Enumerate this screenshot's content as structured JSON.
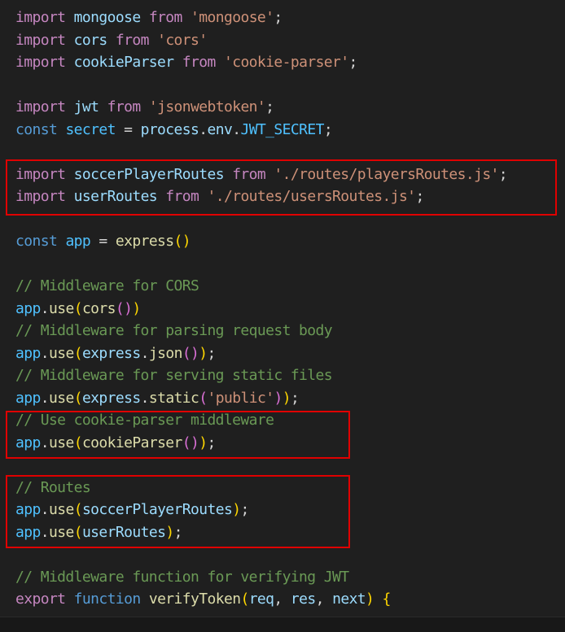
{
  "editor": {
    "language": "javascript",
    "lines": [
      {
        "tokens": [
          {
            "t": "import",
            "c": "kw"
          },
          {
            "t": " ",
            "c": "pl"
          },
          {
            "t": "mongoose",
            "c": "var"
          },
          {
            "t": " ",
            "c": "pl"
          },
          {
            "t": "from",
            "c": "kw"
          },
          {
            "t": " ",
            "c": "pl"
          },
          {
            "t": "'mongoose'",
            "c": "str"
          },
          {
            "t": ";",
            "c": "pl"
          }
        ]
      },
      {
        "tokens": [
          {
            "t": "import",
            "c": "kw"
          },
          {
            "t": " ",
            "c": "pl"
          },
          {
            "t": "cors",
            "c": "var"
          },
          {
            "t": " ",
            "c": "pl"
          },
          {
            "t": "from",
            "c": "kw"
          },
          {
            "t": " ",
            "c": "pl"
          },
          {
            "t": "'cors'",
            "c": "str"
          }
        ]
      },
      {
        "tokens": [
          {
            "t": "import",
            "c": "kw"
          },
          {
            "t": " ",
            "c": "pl"
          },
          {
            "t": "cookieParser",
            "c": "var"
          },
          {
            "t": " ",
            "c": "pl"
          },
          {
            "t": "from",
            "c": "kw"
          },
          {
            "t": " ",
            "c": "pl"
          },
          {
            "t": "'cookie-parser'",
            "c": "str"
          },
          {
            "t": ";",
            "c": "pl"
          }
        ]
      },
      {
        "tokens": []
      },
      {
        "tokens": [
          {
            "t": "import",
            "c": "kw"
          },
          {
            "t": " ",
            "c": "pl"
          },
          {
            "t": "jwt",
            "c": "var"
          },
          {
            "t": " ",
            "c": "pl"
          },
          {
            "t": "from",
            "c": "kw"
          },
          {
            "t": " ",
            "c": "pl"
          },
          {
            "t": "'jsonwebtoken'",
            "c": "str"
          },
          {
            "t": ";",
            "c": "pl"
          }
        ]
      },
      {
        "tokens": [
          {
            "t": "const",
            "c": "st"
          },
          {
            "t": " ",
            "c": "pl"
          },
          {
            "t": "secret",
            "c": "cv"
          },
          {
            "t": " = ",
            "c": "pl"
          },
          {
            "t": "process",
            "c": "var"
          },
          {
            "t": ".",
            "c": "pl"
          },
          {
            "t": "env",
            "c": "var"
          },
          {
            "t": ".",
            "c": "pl"
          },
          {
            "t": "JWT_SECRET",
            "c": "cv"
          },
          {
            "t": ";",
            "c": "pl"
          }
        ]
      },
      {
        "tokens": []
      },
      {
        "tokens": [
          {
            "t": "import",
            "c": "kw"
          },
          {
            "t": " ",
            "c": "pl"
          },
          {
            "t": "soccerPlayerRoutes",
            "c": "var"
          },
          {
            "t": " ",
            "c": "pl"
          },
          {
            "t": "from",
            "c": "kw"
          },
          {
            "t": " ",
            "c": "pl"
          },
          {
            "t": "'./routes/playersRoutes.js'",
            "c": "str"
          },
          {
            "t": ";",
            "c": "pl"
          }
        ]
      },
      {
        "tokens": [
          {
            "t": "import",
            "c": "kw"
          },
          {
            "t": " ",
            "c": "pl"
          },
          {
            "t": "userRoutes",
            "c": "var"
          },
          {
            "t": " ",
            "c": "pl"
          },
          {
            "t": "from",
            "c": "kw"
          },
          {
            "t": " ",
            "c": "pl"
          },
          {
            "t": "'./routes/usersRoutes.js'",
            "c": "str"
          },
          {
            "t": ";",
            "c": "pl"
          }
        ]
      },
      {
        "tokens": []
      },
      {
        "tokens": [
          {
            "t": "const",
            "c": "st"
          },
          {
            "t": " ",
            "c": "pl"
          },
          {
            "t": "app",
            "c": "cv"
          },
          {
            "t": " = ",
            "c": "pl"
          },
          {
            "t": "express",
            "c": "fn"
          },
          {
            "t": "()",
            "c": "b1"
          }
        ]
      },
      {
        "tokens": []
      },
      {
        "tokens": [
          {
            "t": "// Middleware for CORS",
            "c": "cm"
          }
        ]
      },
      {
        "tokens": [
          {
            "t": "app",
            "c": "cv"
          },
          {
            "t": ".",
            "c": "pl"
          },
          {
            "t": "use",
            "c": "fn"
          },
          {
            "t": "(",
            "c": "b1"
          },
          {
            "t": "cors",
            "c": "fn"
          },
          {
            "t": "()",
            "c": "b2"
          },
          {
            "t": ")",
            "c": "b1"
          }
        ]
      },
      {
        "tokens": [
          {
            "t": "// Middleware for parsing request body",
            "c": "cm"
          }
        ]
      },
      {
        "tokens": [
          {
            "t": "app",
            "c": "cv"
          },
          {
            "t": ".",
            "c": "pl"
          },
          {
            "t": "use",
            "c": "fn"
          },
          {
            "t": "(",
            "c": "b1"
          },
          {
            "t": "express",
            "c": "var"
          },
          {
            "t": ".",
            "c": "pl"
          },
          {
            "t": "json",
            "c": "fn"
          },
          {
            "t": "()",
            "c": "b2"
          },
          {
            "t": ")",
            "c": "b1"
          },
          {
            "t": ";",
            "c": "pl"
          }
        ]
      },
      {
        "tokens": [
          {
            "t": "// Middleware for serving static files",
            "c": "cm"
          }
        ]
      },
      {
        "tokens": [
          {
            "t": "app",
            "c": "cv"
          },
          {
            "t": ".",
            "c": "pl"
          },
          {
            "t": "use",
            "c": "fn"
          },
          {
            "t": "(",
            "c": "b1"
          },
          {
            "t": "express",
            "c": "var"
          },
          {
            "t": ".",
            "c": "pl"
          },
          {
            "t": "static",
            "c": "fn"
          },
          {
            "t": "(",
            "c": "b2"
          },
          {
            "t": "'public'",
            "c": "str"
          },
          {
            "t": ")",
            "c": "b2"
          },
          {
            "t": ")",
            "c": "b1"
          },
          {
            "t": ";",
            "c": "pl"
          }
        ]
      },
      {
        "tokens": [
          {
            "t": "// Use cookie-parser middleware",
            "c": "cm"
          }
        ]
      },
      {
        "tokens": [
          {
            "t": "app",
            "c": "cv"
          },
          {
            "t": ".",
            "c": "pl"
          },
          {
            "t": "use",
            "c": "fn"
          },
          {
            "t": "(",
            "c": "b1"
          },
          {
            "t": "cookieParser",
            "c": "fn"
          },
          {
            "t": "()",
            "c": "b2"
          },
          {
            "t": ")",
            "c": "b1"
          },
          {
            "t": ";",
            "c": "pl"
          }
        ]
      },
      {
        "tokens": []
      },
      {
        "tokens": [
          {
            "t": "// Routes",
            "c": "cm"
          }
        ]
      },
      {
        "tokens": [
          {
            "t": "app",
            "c": "cv"
          },
          {
            "t": ".",
            "c": "pl"
          },
          {
            "t": "use",
            "c": "fn"
          },
          {
            "t": "(",
            "c": "b1"
          },
          {
            "t": "soccerPlayerRoutes",
            "c": "var"
          },
          {
            "t": ")",
            "c": "b1"
          },
          {
            "t": ";",
            "c": "pl"
          }
        ]
      },
      {
        "tokens": [
          {
            "t": "app",
            "c": "cv"
          },
          {
            "t": ".",
            "c": "pl"
          },
          {
            "t": "use",
            "c": "fn"
          },
          {
            "t": "(",
            "c": "b1"
          },
          {
            "t": "userRoutes",
            "c": "var"
          },
          {
            "t": ")",
            "c": "b1"
          },
          {
            "t": ";",
            "c": "pl"
          }
        ]
      },
      {
        "tokens": []
      },
      {
        "tokens": [
          {
            "t": "// Middleware function for verifying JWT",
            "c": "cm"
          }
        ]
      },
      {
        "tokens": [
          {
            "t": "export",
            "c": "kw"
          },
          {
            "t": " ",
            "c": "pl"
          },
          {
            "t": "function",
            "c": "st"
          },
          {
            "t": " ",
            "c": "pl"
          },
          {
            "t": "verifyToken",
            "c": "fn"
          },
          {
            "t": "(",
            "c": "b1"
          },
          {
            "t": "req",
            "c": "var"
          },
          {
            "t": ", ",
            "c": "pl"
          },
          {
            "t": "res",
            "c": "var"
          },
          {
            "t": ", ",
            "c": "pl"
          },
          {
            "t": "next",
            "c": "var"
          },
          {
            "t": ")",
            "c": "b1"
          },
          {
            "t": " ",
            "c": "pl"
          },
          {
            "t": "{",
            "c": "b1"
          }
        ]
      }
    ]
  },
  "highlights": [
    {
      "label": "route-imports",
      "lines": [
        7,
        8
      ]
    },
    {
      "label": "cookie-parser-middleware",
      "lines": [
        18,
        19
      ]
    },
    {
      "label": "routes-usage",
      "lines": [
        21,
        22,
        23
      ]
    }
  ],
  "colors": {
    "background": "#1f1f1f",
    "highlight_border": "#e00000"
  }
}
